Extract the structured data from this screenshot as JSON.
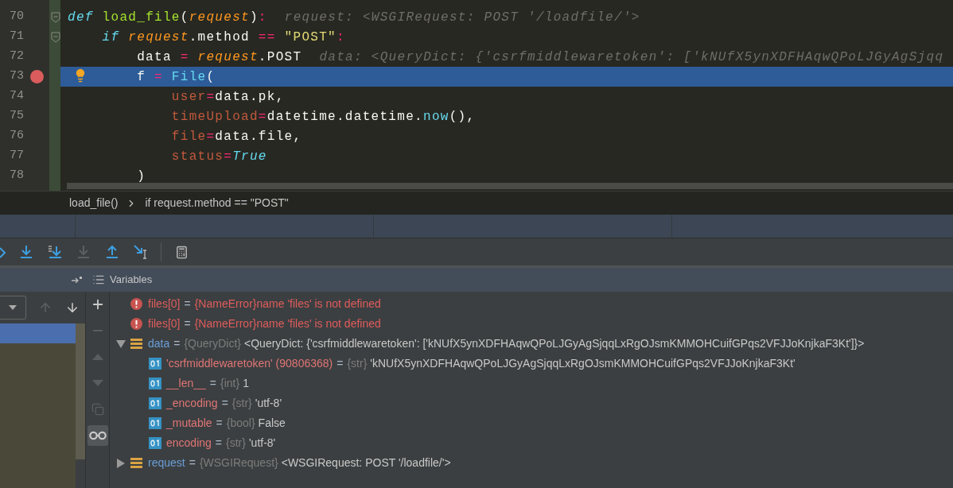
{
  "editor": {
    "lines": [
      {
        "number": "70",
        "fold": true,
        "tokens": [
          {
            "kind": "keyword",
            "text": "def"
          },
          {
            "kind": "function",
            "text": " load_file"
          },
          {
            "kind": "plain",
            "text": "("
          },
          {
            "kind": "param",
            "text": "request"
          },
          {
            "kind": "plain",
            "text": ")"
          },
          {
            "kind": "operator",
            "text": ":"
          }
        ],
        "hint": "request: <WSGIRequest: POST '/loadfile/'>"
      },
      {
        "number": "71",
        "fold": true,
        "tokens": [
          {
            "kind": "keyword",
            "text": "    if"
          },
          {
            "kind": "param",
            "text": " request"
          },
          {
            "kind": "plain",
            "text": ".method "
          },
          {
            "kind": "operator",
            "text": "=="
          },
          {
            "kind": "string",
            "text": " \"POST\""
          },
          {
            "kind": "operator",
            "text": ":"
          }
        ]
      },
      {
        "number": "72",
        "tokens": [
          {
            "kind": "plain",
            "text": "        data "
          },
          {
            "kind": "operator",
            "text": "="
          },
          {
            "kind": "param",
            "text": " request"
          },
          {
            "kind": "plain",
            "text": ".POST"
          }
        ],
        "hint": "data: <QueryDict: {'csrfmiddlewaretoken': ['kNUfX5ynXDFHAqwQPoLJGyAgSjqq"
      },
      {
        "number": "73",
        "breakpoint": true,
        "current": true,
        "bulb": true,
        "tokens": [
          {
            "kind": "plain",
            "text": "        f "
          },
          {
            "kind": "operator",
            "text": "="
          },
          {
            "kind": "builtin",
            "text": " File"
          },
          {
            "kind": "plain",
            "text": "("
          }
        ]
      },
      {
        "number": "74",
        "tokens": [
          {
            "kind": "named_arg",
            "text": "            user"
          },
          {
            "kind": "operator",
            "text": "="
          },
          {
            "kind": "plain",
            "text": "data.pk,"
          }
        ]
      },
      {
        "number": "75",
        "tokens": [
          {
            "kind": "named_arg",
            "text": "            timeUpload"
          },
          {
            "kind": "operator",
            "text": "="
          },
          {
            "kind": "plain",
            "text": "datetime.datetime."
          },
          {
            "kind": "builtin",
            "text": "now"
          },
          {
            "kind": "plain",
            "text": "(),"
          }
        ]
      },
      {
        "number": "76",
        "tokens": [
          {
            "kind": "named_arg",
            "text": "            file"
          },
          {
            "kind": "operator",
            "text": "="
          },
          {
            "kind": "plain",
            "text": "data.file,"
          }
        ]
      },
      {
        "number": "77",
        "tokens": [
          {
            "kind": "named_arg",
            "text": "            status"
          },
          {
            "kind": "operator",
            "text": "="
          },
          {
            "kind": "constant",
            "text": "True"
          }
        ]
      },
      {
        "number": "78",
        "tokens": [
          {
            "kind": "plain",
            "text": "        )"
          }
        ]
      }
    ]
  },
  "breadcrumb": [
    "load_file()",
    "if request.method == \"POST\""
  ],
  "toolbar": [
    {
      "kind": "step_partial",
      "disabled": false
    },
    {
      "kind": "step_into",
      "disabled": false
    },
    {
      "kind": "step_into_my",
      "disabled": false
    },
    {
      "kind": "force_step",
      "disabled": true
    },
    {
      "kind": "step_out",
      "disabled": false
    },
    {
      "kind": "run_to_cursor",
      "disabled": false
    },
    {
      "kind": "evaluate",
      "disabled": false
    }
  ],
  "panel_title": "Variables",
  "frames": [
    {
      "selected": true
    }
  ],
  "frame_nav": [
    {
      "kind": "up",
      "disabled": true
    },
    {
      "kind": "down",
      "disabled": false
    }
  ],
  "side_tools": [
    {
      "kind": "add",
      "disabled": false,
      "selected": false
    },
    {
      "kind": "remove",
      "disabled": true,
      "selected": false
    },
    {
      "kind": "up",
      "disabled": true,
      "selected": false
    },
    {
      "kind": "down",
      "disabled": true,
      "selected": false
    },
    {
      "kind": "copy",
      "disabled": true,
      "selected": false
    },
    {
      "kind": "watch",
      "disabled": false,
      "selected": true
    }
  ],
  "variables": [
    {
      "kind": "error",
      "name": "files[0]",
      "sign": "=",
      "type": "{NameError}",
      "value": "name 'files' is not defined"
    },
    {
      "kind": "error",
      "name": "files[0]",
      "sign": "=",
      "type": "{NameError}",
      "value": "name 'files' is not defined"
    },
    {
      "kind": "object",
      "name": "data",
      "sign": "=",
      "type": "{QueryDict}",
      "value": "<QueryDict: {'csrfmiddlewaretoken': ['kNUfX5ynXDFHAqwQPoLJGyAgSjqqLxRgOJsmKMMOHCuifGPqs2VFJJoKnjkaF3Kt']}>",
      "expanded": true,
      "children": [
        {
          "kind": "field",
          "name": "'csrfmiddlewaretoken' (90806368)",
          "sign": "=",
          "type": "{str}",
          "value": "'kNUfX5ynXDFHAqwQPoLJGyAgSjqqLxRgOJsmKMMOHCuifGPqs2VFJJoKnjkaF3Kt'"
        },
        {
          "kind": "field",
          "name": "__len__",
          "sign": "=",
          "type": "{int}",
          "value": "1"
        },
        {
          "kind": "field",
          "name": "_encoding",
          "sign": "=",
          "type": "{str}",
          "value": "'utf-8'"
        },
        {
          "kind": "field",
          "name": "_mutable",
          "sign": "=",
          "type": "{bool}",
          "value": "False"
        },
        {
          "kind": "field",
          "name": "encoding",
          "sign": "=",
          "type": "{str}",
          "value": "'utf-8'"
        }
      ]
    },
    {
      "kind": "object",
      "name": "request",
      "sign": "=",
      "type": "{WSGIRequest}",
      "value": "<WSGIRequest: POST '/loadfile/'>",
      "expanded": false
    }
  ]
}
